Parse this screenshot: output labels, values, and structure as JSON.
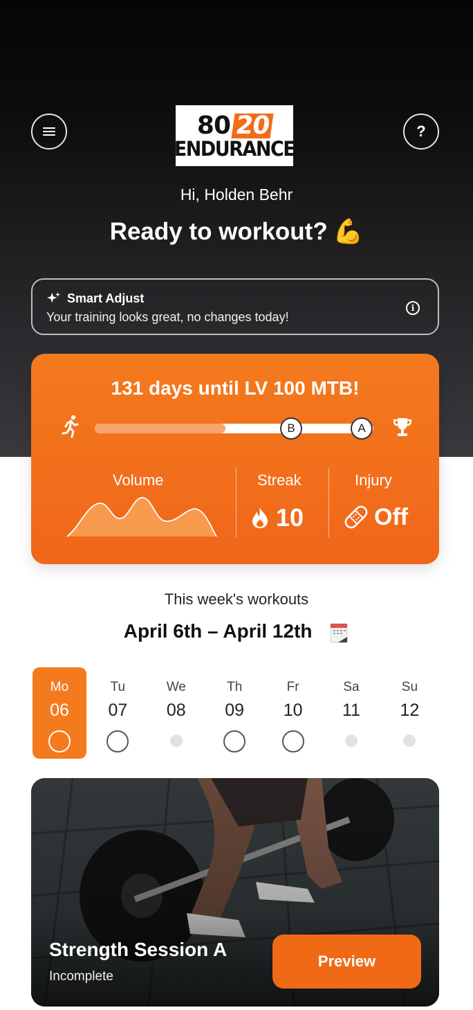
{
  "header": {
    "logo_line1_a": "80",
    "logo_line1_b": "20",
    "logo_line2": "ENDURANCE",
    "menu_icon": "hamburger-icon",
    "help_label": "?"
  },
  "greeting": {
    "hello": "Hi, Holden Behr",
    "headline": "Ready to workout?",
    "emoji": "💪"
  },
  "smart_adjust": {
    "title": "Smart Adjust",
    "message": "Your training looks great, no changes today!",
    "icon": "sparkle-icon",
    "info_icon": "info-icon"
  },
  "goal": {
    "title": "131 days until LV 100 MTB!",
    "progress": 0.47,
    "marker_b": "B",
    "marker_a": "A",
    "volume_label": "Volume",
    "streak_label": "Streak",
    "streak_value": "10",
    "injury_label": "Injury",
    "injury_value": "Off",
    "colors": {
      "accent": "#f47a1e",
      "track": "#ffffff",
      "fill": "#f8a46a"
    }
  },
  "week": {
    "subtitle": "This week's workouts",
    "range": "April 6th – April 12th",
    "days": [
      {
        "name": "Mo",
        "date": "06",
        "state": "ring",
        "active": true
      },
      {
        "name": "Tu",
        "date": "07",
        "state": "ring",
        "active": false
      },
      {
        "name": "We",
        "date": "08",
        "state": "rest",
        "active": false
      },
      {
        "name": "Th",
        "date": "09",
        "state": "ring",
        "active": false
      },
      {
        "name": "Fr",
        "date": "10",
        "state": "ring",
        "active": false
      },
      {
        "name": "Sa",
        "date": "11",
        "state": "rest",
        "active": false
      },
      {
        "name": "Su",
        "date": "12",
        "state": "rest",
        "active": false
      }
    ]
  },
  "workout": {
    "title": "Strength Session A",
    "status": "Incomplete",
    "button": "Preview"
  }
}
